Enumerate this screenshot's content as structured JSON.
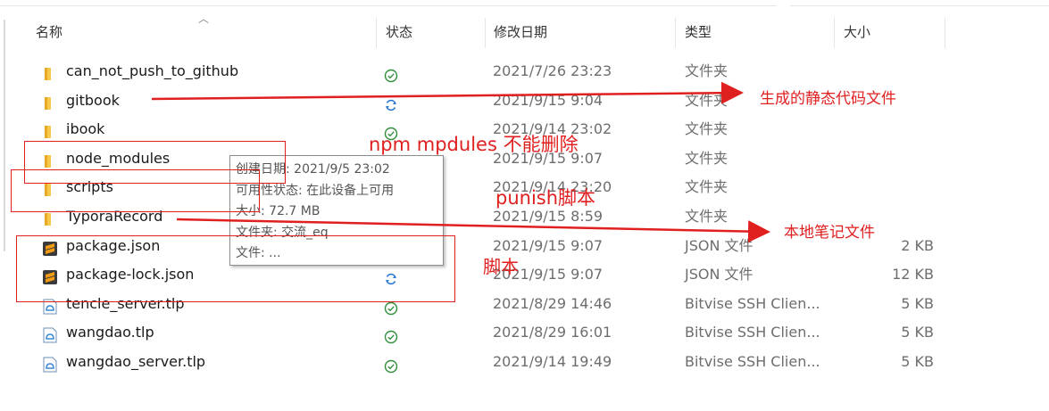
{
  "columns": {
    "name": "名称",
    "status": "状态",
    "modified": "修改日期",
    "type": "类型",
    "size": "大小"
  },
  "files": [
    {
      "name": "can_not_push_to_github",
      "status": "synced",
      "date": "2021/7/26 23:23",
      "type": "文件夹",
      "size": "",
      "icon": "folder-icon"
    },
    {
      "name": "gitbook",
      "status": "syncing",
      "date": "2021/9/15 9:04",
      "type": "文件夹",
      "size": "",
      "icon": "folder-icon"
    },
    {
      "name": "ibook",
      "status": "synced",
      "date": "2021/9/14 23:02",
      "type": "文件夹",
      "size": "",
      "icon": "folder-icon"
    },
    {
      "name": "node_modules",
      "status": "syncing",
      "date": "2021/9/15 9:07",
      "type": "文件夹",
      "size": "",
      "icon": "folder-icon"
    },
    {
      "name": "scripts",
      "status": "syncing",
      "date": "2021/9/14 23:20",
      "type": "文件夹",
      "size": "",
      "icon": "folder-icon"
    },
    {
      "name": "TyporaRecord",
      "status": "syncing",
      "date": "2021/9/15 8:59",
      "type": "文件夹",
      "size": "",
      "icon": "folder-icon"
    },
    {
      "name": "package.json",
      "status": "syncing",
      "date": "2021/9/15 9:07",
      "type": "JSON 文件",
      "size": "2 KB",
      "icon": "sublime-file-icon"
    },
    {
      "name": "package-lock.json",
      "status": "syncing",
      "date": "2021/9/15 9:07",
      "type": "JSON 文件",
      "size": "12 KB",
      "icon": "sublime-file-icon"
    },
    {
      "name": "tencle_server.tlp",
      "status": "synced",
      "date": "2021/8/29 14:46",
      "type": "Bitvise SSH Clien...",
      "size": "5 KB",
      "icon": "bitvise-file-icon"
    },
    {
      "name": "wangdao.tlp",
      "status": "synced",
      "date": "2021/8/29 16:01",
      "type": "Bitvise SSH Clien...",
      "size": "5 KB",
      "icon": "bitvise-file-icon"
    },
    {
      "name": "wangdao_server.tlp",
      "status": "synced",
      "date": "2021/9/14 19:49",
      "type": "Bitvise SSH Clien...",
      "size": "5 KB",
      "icon": "bitvise-file-icon"
    }
  ],
  "tooltip": {
    "created": "创建日期: 2021/9/5 23:02",
    "availability": "可用性状态: 在此设备上可用",
    "size": "大小: 72.7 MB",
    "folders": "文件夹: 交流_eq",
    "files": "文件: ..."
  },
  "annotations": {
    "gitbook": "生成的静态代码文件",
    "node_modules": "npm  mpdules 不能删除",
    "scripts": "punish脚本",
    "typora": "本地笔记文件",
    "package": "脚本"
  },
  "colors": {
    "annotation": "#e01f1f",
    "synced": "#2f8f3a",
    "syncing": "#1f6fd1",
    "folder": "#f3c244"
  }
}
